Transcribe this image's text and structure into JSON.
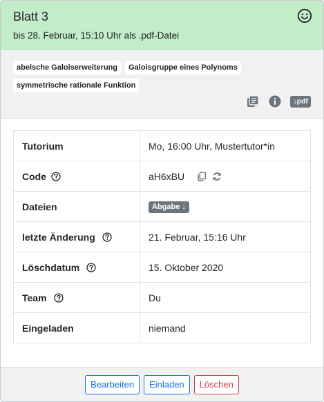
{
  "header": {
    "title": "Blatt 3",
    "subtitle": "bis 28. Februar, 15:10 Uhr als .pdf-Datei",
    "status_icon": "smiley-icon"
  },
  "tags": [
    "abelsche Galoiserweiterung",
    "Galoisgruppe eines Polynoms",
    "symmetrische rationale Funktion"
  ],
  "tools": {
    "icons": [
      "library-icon",
      "info-icon"
    ],
    "pdf_label": "↓pdf"
  },
  "table": {
    "tutorium": {
      "label": "Tutorium",
      "value": "Mo, 16:00 Uhr, Mustertutor*in"
    },
    "code": {
      "label": "Code",
      "value": "aH6xBU"
    },
    "dateien": {
      "label": "Dateien",
      "value": "Abgabe ↓"
    },
    "aenderung": {
      "label": "letzte Änderung",
      "value": "21. Februar, 15:16 Uhr"
    },
    "loeschdatum": {
      "label": "Löschdatum",
      "value": "15. Oktober 2020"
    },
    "team": {
      "label": "Team",
      "value": "Du"
    },
    "eingeladen": {
      "label": "Eingeladen",
      "value": "niemand"
    }
  },
  "footer": {
    "edit": "Bearbeiten",
    "invite": "Einladen",
    "delete": "Löschen"
  },
  "colors": {
    "header_bg": "#c3ecc8",
    "primary": "#0d6efd",
    "danger": "#dc3545",
    "badge": "#6c757d"
  }
}
